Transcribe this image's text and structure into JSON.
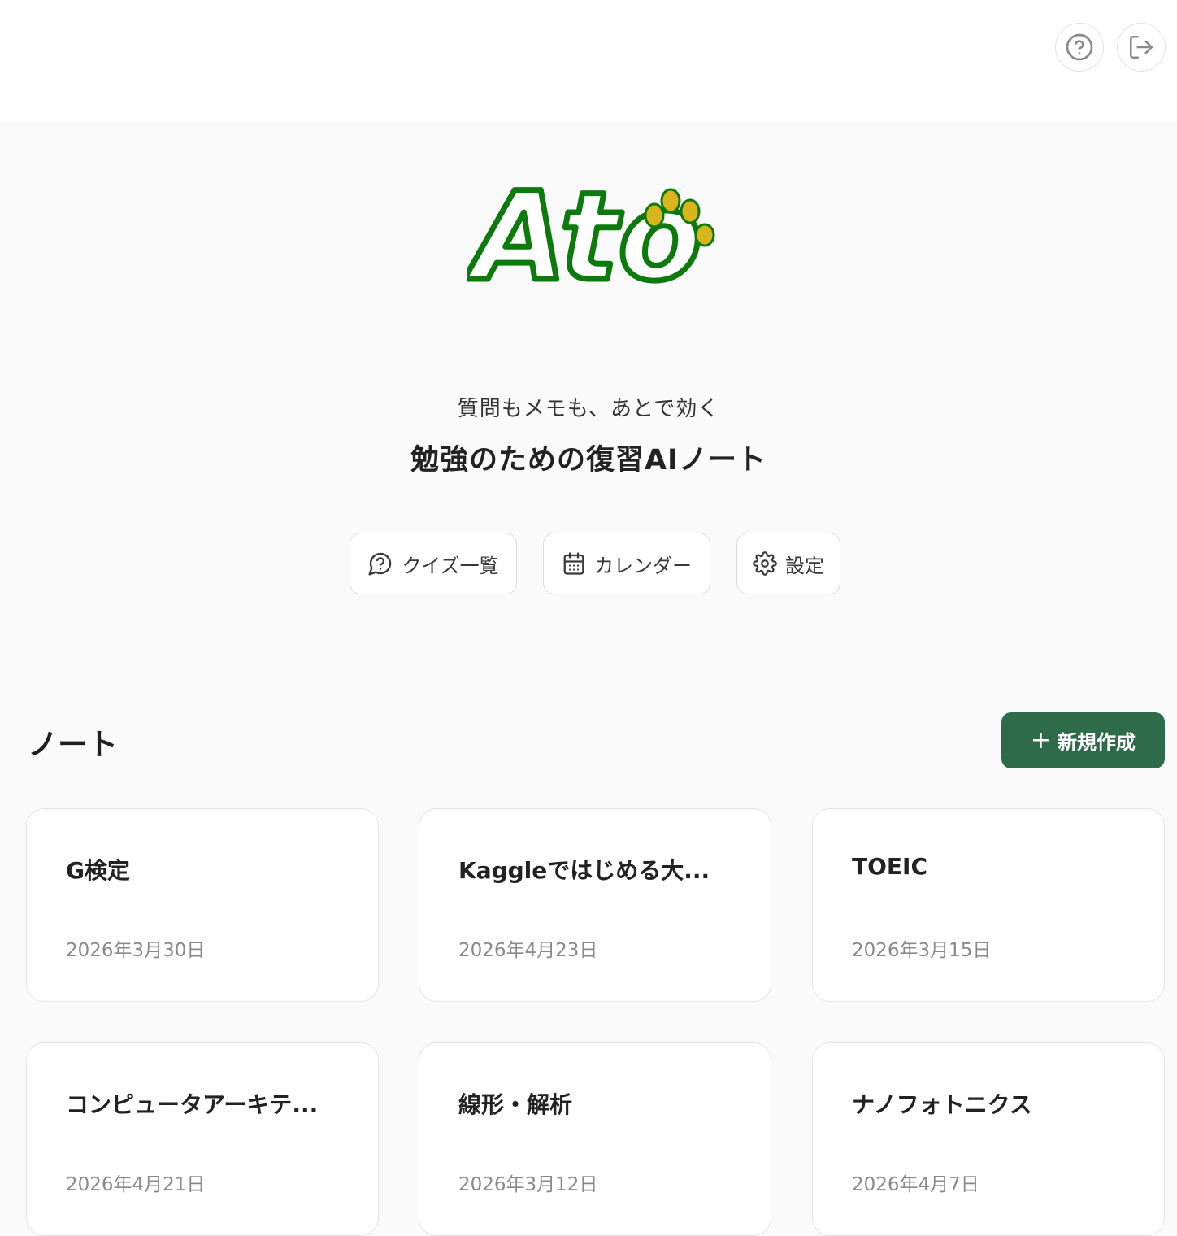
{
  "header": {
    "help_icon": "help-circle-icon",
    "logout_icon": "logout-icon"
  },
  "brand": {
    "logo_text": "Ato",
    "logo_color": "#0d7a0d",
    "paw_color": "#d9b41a"
  },
  "hero": {
    "tagline": "質問もメモも、あとで効く",
    "title": "勉強のための復習AIノート"
  },
  "nav": {
    "quiz_label": "クイズ一覧",
    "calendar_label": "カレンダー",
    "settings_label": "設定"
  },
  "notes": {
    "section_title": "ノート",
    "new_button_label": "新規作成",
    "accent_color": "#2e6b4a",
    "items": [
      {
        "title": "G検定",
        "date": "2026年3月30日"
      },
      {
        "title": "Kaggleではじめる大...",
        "date": "2026年4月23日"
      },
      {
        "title": "TOEIC",
        "date": "2026年3月15日"
      },
      {
        "title": "コンピュータアーキテ...",
        "date": "2026年4月21日"
      },
      {
        "title": "線形・解析",
        "date": "2026年3月12日"
      },
      {
        "title": "ナノフォトニクス",
        "date": "2026年4月7日"
      }
    ]
  }
}
